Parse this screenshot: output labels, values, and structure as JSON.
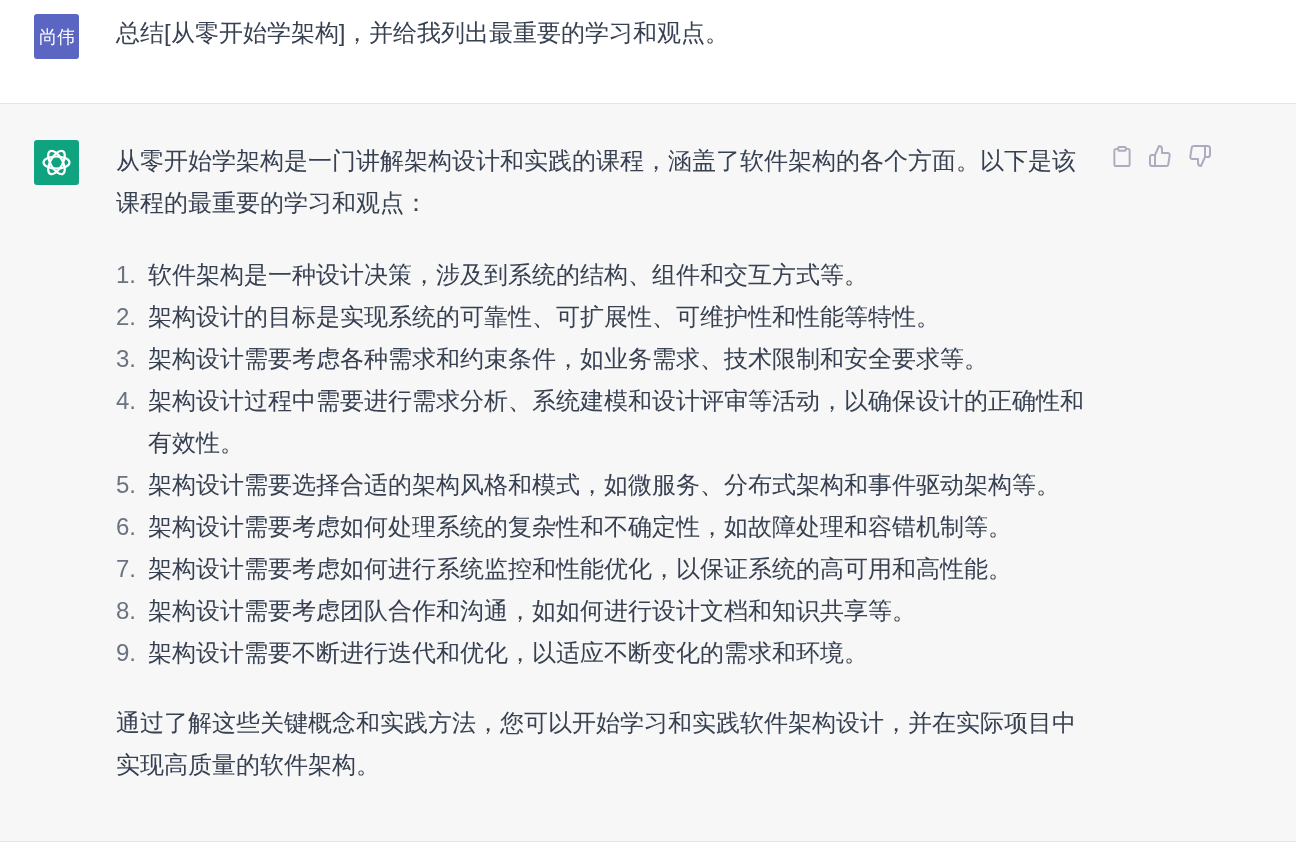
{
  "user_message": {
    "avatar": "尚伟",
    "text": "总结[从零开始学架构]，并给我列出最重要的学习和观点。"
  },
  "assistant_message": {
    "intro": "从零开始学架构是一门讲解架构设计和实践的课程，涵盖了软件架构的各个方面。以下是该课程的最重要的学习和观点：",
    "points": [
      {
        "number": "1.",
        "text": "软件架构是一种设计决策，涉及到系统的结构、组件和交互方式等。"
      },
      {
        "number": "2.",
        "text": "架构设计的目标是实现系统的可靠性、可扩展性、可维护性和性能等特性。"
      },
      {
        "number": "3.",
        "text": "架构设计需要考虑各种需求和约束条件，如业务需求、技术限制和安全要求等。"
      },
      {
        "number": "4.",
        "text": "架构设计过程中需要进行需求分析、系统建模和设计评审等活动，以确保设计的正确性和有效性。"
      },
      {
        "number": "5.",
        "text": "架构设计需要选择合适的架构风格和模式，如微服务、分布式架构和事件驱动架构等。"
      },
      {
        "number": "6.",
        "text": "架构设计需要考虑如何处理系统的复杂性和不确定性，如故障处理和容错机制等。"
      },
      {
        "number": "7.",
        "text": "架构设计需要考虑如何进行系统监控和性能优化，以保证系统的高可用和高性能。"
      },
      {
        "number": "8.",
        "text": "架构设计需要考虑团队合作和沟通，如如何进行设计文档和知识共享等。"
      },
      {
        "number": "9.",
        "text": "架构设计需要不断进行迭代和优化，以适应不断变化的需求和环境。"
      }
    ],
    "conclusion": "通过了解这些关键概念和实践方法，您可以开始学习和实践软件架构设计，并在实际项目中实现高质量的软件架构。"
  }
}
